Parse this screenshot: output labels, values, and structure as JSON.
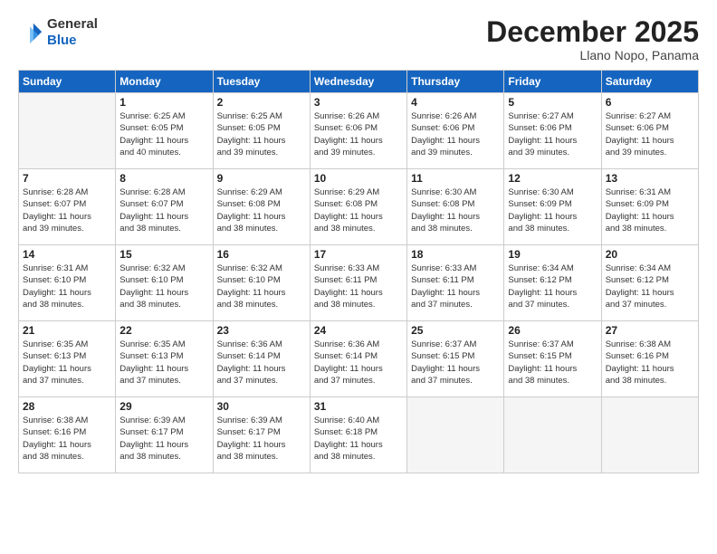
{
  "logo": {
    "general": "General",
    "blue": "Blue"
  },
  "title": "December 2025",
  "location": "Llano Nopo, Panama",
  "days_header": [
    "Sunday",
    "Monday",
    "Tuesday",
    "Wednesday",
    "Thursday",
    "Friday",
    "Saturday"
  ],
  "weeks": [
    [
      {
        "day": "",
        "info": ""
      },
      {
        "day": "1",
        "info": "Sunrise: 6:25 AM\nSunset: 6:05 PM\nDaylight: 11 hours\nand 40 minutes."
      },
      {
        "day": "2",
        "info": "Sunrise: 6:25 AM\nSunset: 6:05 PM\nDaylight: 11 hours\nand 39 minutes."
      },
      {
        "day": "3",
        "info": "Sunrise: 6:26 AM\nSunset: 6:06 PM\nDaylight: 11 hours\nand 39 minutes."
      },
      {
        "day": "4",
        "info": "Sunrise: 6:26 AM\nSunset: 6:06 PM\nDaylight: 11 hours\nand 39 minutes."
      },
      {
        "day": "5",
        "info": "Sunrise: 6:27 AM\nSunset: 6:06 PM\nDaylight: 11 hours\nand 39 minutes."
      },
      {
        "day": "6",
        "info": "Sunrise: 6:27 AM\nSunset: 6:06 PM\nDaylight: 11 hours\nand 39 minutes."
      }
    ],
    [
      {
        "day": "7",
        "info": "Sunrise: 6:28 AM\nSunset: 6:07 PM\nDaylight: 11 hours\nand 39 minutes."
      },
      {
        "day": "8",
        "info": "Sunrise: 6:28 AM\nSunset: 6:07 PM\nDaylight: 11 hours\nand 38 minutes."
      },
      {
        "day": "9",
        "info": "Sunrise: 6:29 AM\nSunset: 6:08 PM\nDaylight: 11 hours\nand 38 minutes."
      },
      {
        "day": "10",
        "info": "Sunrise: 6:29 AM\nSunset: 6:08 PM\nDaylight: 11 hours\nand 38 minutes."
      },
      {
        "day": "11",
        "info": "Sunrise: 6:30 AM\nSunset: 6:08 PM\nDaylight: 11 hours\nand 38 minutes."
      },
      {
        "day": "12",
        "info": "Sunrise: 6:30 AM\nSunset: 6:09 PM\nDaylight: 11 hours\nand 38 minutes."
      },
      {
        "day": "13",
        "info": "Sunrise: 6:31 AM\nSunset: 6:09 PM\nDaylight: 11 hours\nand 38 minutes."
      }
    ],
    [
      {
        "day": "14",
        "info": "Sunrise: 6:31 AM\nSunset: 6:10 PM\nDaylight: 11 hours\nand 38 minutes."
      },
      {
        "day": "15",
        "info": "Sunrise: 6:32 AM\nSunset: 6:10 PM\nDaylight: 11 hours\nand 38 minutes."
      },
      {
        "day": "16",
        "info": "Sunrise: 6:32 AM\nSunset: 6:10 PM\nDaylight: 11 hours\nand 38 minutes."
      },
      {
        "day": "17",
        "info": "Sunrise: 6:33 AM\nSunset: 6:11 PM\nDaylight: 11 hours\nand 38 minutes."
      },
      {
        "day": "18",
        "info": "Sunrise: 6:33 AM\nSunset: 6:11 PM\nDaylight: 11 hours\nand 37 minutes."
      },
      {
        "day": "19",
        "info": "Sunrise: 6:34 AM\nSunset: 6:12 PM\nDaylight: 11 hours\nand 37 minutes."
      },
      {
        "day": "20",
        "info": "Sunrise: 6:34 AM\nSunset: 6:12 PM\nDaylight: 11 hours\nand 37 minutes."
      }
    ],
    [
      {
        "day": "21",
        "info": "Sunrise: 6:35 AM\nSunset: 6:13 PM\nDaylight: 11 hours\nand 37 minutes."
      },
      {
        "day": "22",
        "info": "Sunrise: 6:35 AM\nSunset: 6:13 PM\nDaylight: 11 hours\nand 37 minutes."
      },
      {
        "day": "23",
        "info": "Sunrise: 6:36 AM\nSunset: 6:14 PM\nDaylight: 11 hours\nand 37 minutes."
      },
      {
        "day": "24",
        "info": "Sunrise: 6:36 AM\nSunset: 6:14 PM\nDaylight: 11 hours\nand 37 minutes."
      },
      {
        "day": "25",
        "info": "Sunrise: 6:37 AM\nSunset: 6:15 PM\nDaylight: 11 hours\nand 37 minutes."
      },
      {
        "day": "26",
        "info": "Sunrise: 6:37 AM\nSunset: 6:15 PM\nDaylight: 11 hours\nand 38 minutes."
      },
      {
        "day": "27",
        "info": "Sunrise: 6:38 AM\nSunset: 6:16 PM\nDaylight: 11 hours\nand 38 minutes."
      }
    ],
    [
      {
        "day": "28",
        "info": "Sunrise: 6:38 AM\nSunset: 6:16 PM\nDaylight: 11 hours\nand 38 minutes."
      },
      {
        "day": "29",
        "info": "Sunrise: 6:39 AM\nSunset: 6:17 PM\nDaylight: 11 hours\nand 38 minutes."
      },
      {
        "day": "30",
        "info": "Sunrise: 6:39 AM\nSunset: 6:17 PM\nDaylight: 11 hours\nand 38 minutes."
      },
      {
        "day": "31",
        "info": "Sunrise: 6:40 AM\nSunset: 6:18 PM\nDaylight: 11 hours\nand 38 minutes."
      },
      {
        "day": "",
        "info": ""
      },
      {
        "day": "",
        "info": ""
      },
      {
        "day": "",
        "info": ""
      }
    ]
  ]
}
